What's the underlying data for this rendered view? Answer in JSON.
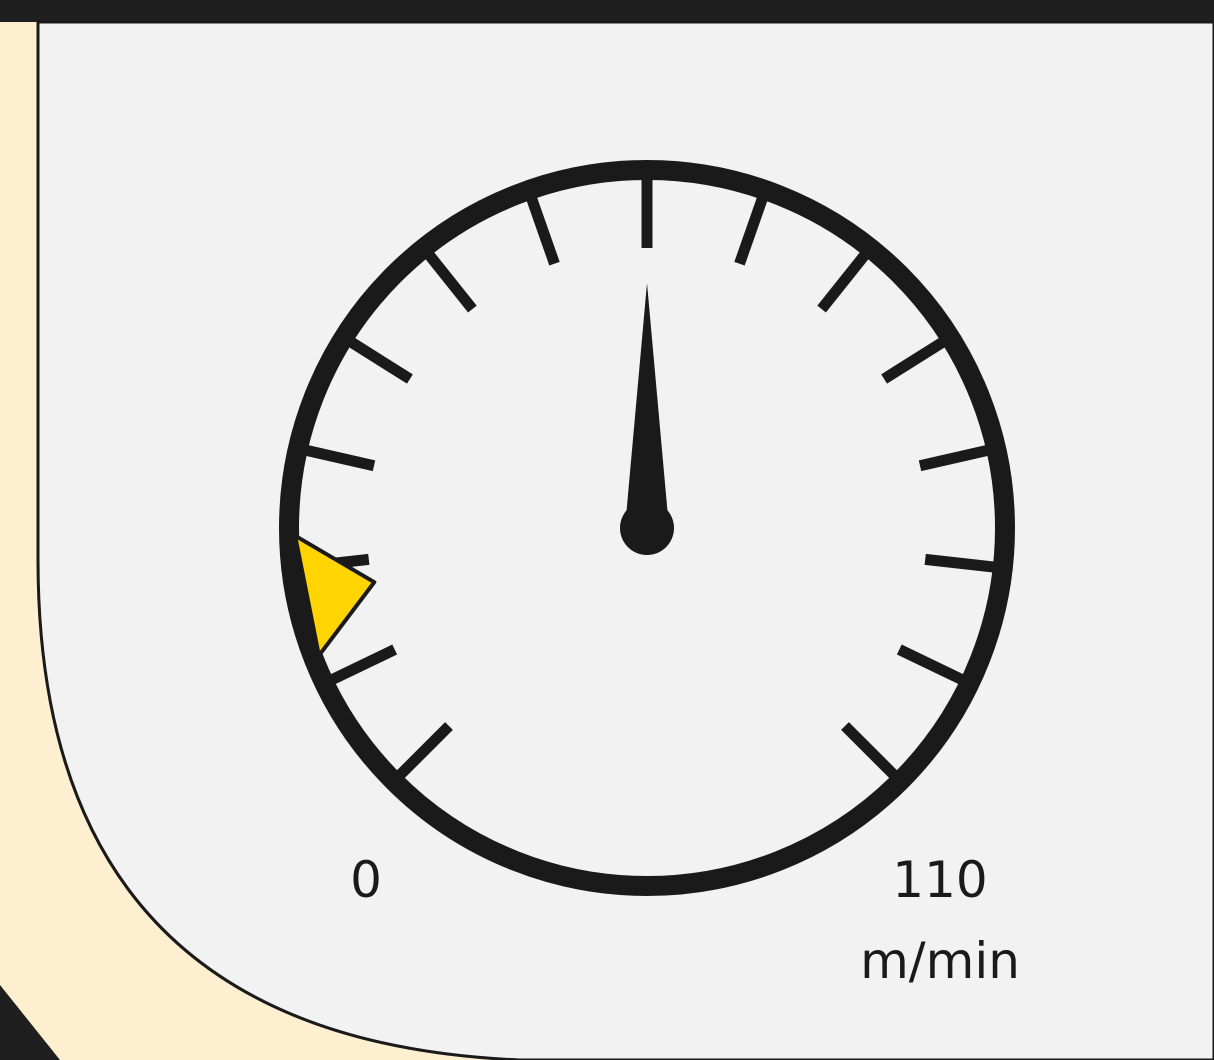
{
  "gauge": {
    "min_label": "0",
    "max_label": "110",
    "unit": "m/min",
    "tick_count": 15,
    "pointer_value_fraction": 0.5,
    "marker_value_fraction": 0.125
  },
  "colors": {
    "background": "#fdefcf",
    "panel": "#f2f2f2",
    "ink": "#1a1a1a",
    "marker": "#ffd400",
    "frame": "#1f1f1f"
  }
}
